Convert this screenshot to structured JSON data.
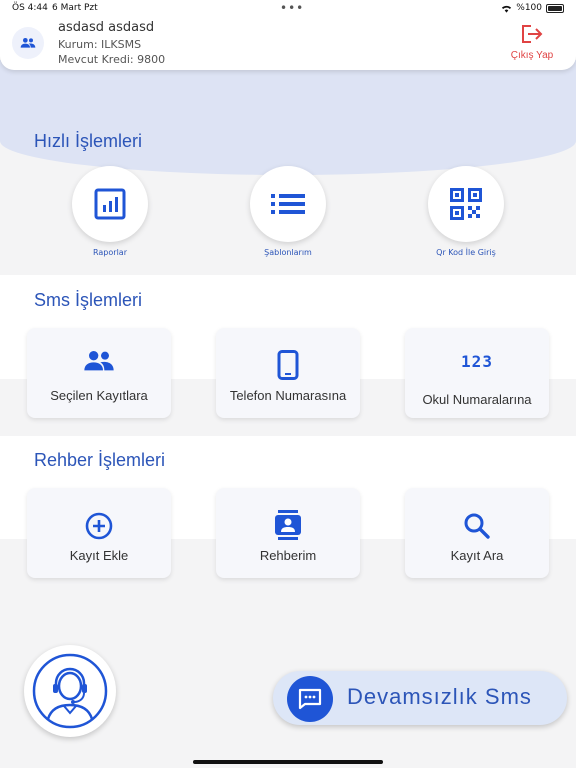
{
  "status_bar": {
    "time": "ÖS 4:44",
    "date": "6 Mart Pzt",
    "battery": "%100"
  },
  "header": {
    "user_name": "asdasd asdasd",
    "kurum": "Kurum: ILKSMS",
    "kredi": "Mevcut Kredi: 9800",
    "logout_label": "Çıkış Yap"
  },
  "quick": {
    "title": "Hızlı İşlemleri",
    "items": [
      {
        "label": "Raporlar",
        "icon": "report-chart-icon"
      },
      {
        "label": "Şablonlarım",
        "icon": "list-icon"
      },
      {
        "label": "Qr Kod İle Giriş",
        "icon": "qr-code-icon"
      }
    ]
  },
  "sms": {
    "title": "Sms İşlemleri",
    "items": [
      {
        "label": "Seçilen Kayıtlara",
        "icon": "people-icon"
      },
      {
        "label": "Telefon Numarasına",
        "icon": "phone-icon"
      },
      {
        "label": "Okul Numaralarına",
        "icon": "123-icon",
        "icon_text": "123"
      }
    ]
  },
  "rehber": {
    "title": "Rehber İşlemleri",
    "items": [
      {
        "label": "Kayıt Ekle",
        "icon": "add-circle-icon"
      },
      {
        "label": "Rehberim",
        "icon": "contact-book-icon"
      },
      {
        "label": "Kayıt Ara",
        "icon": "search-icon"
      }
    ]
  },
  "fab": {
    "label": "Devamsızlık Sms"
  },
  "colors": {
    "primary": "#1f55d6",
    "accent_text": "#2c55b8",
    "logout": "#e04343",
    "band": "#dde3f4"
  }
}
